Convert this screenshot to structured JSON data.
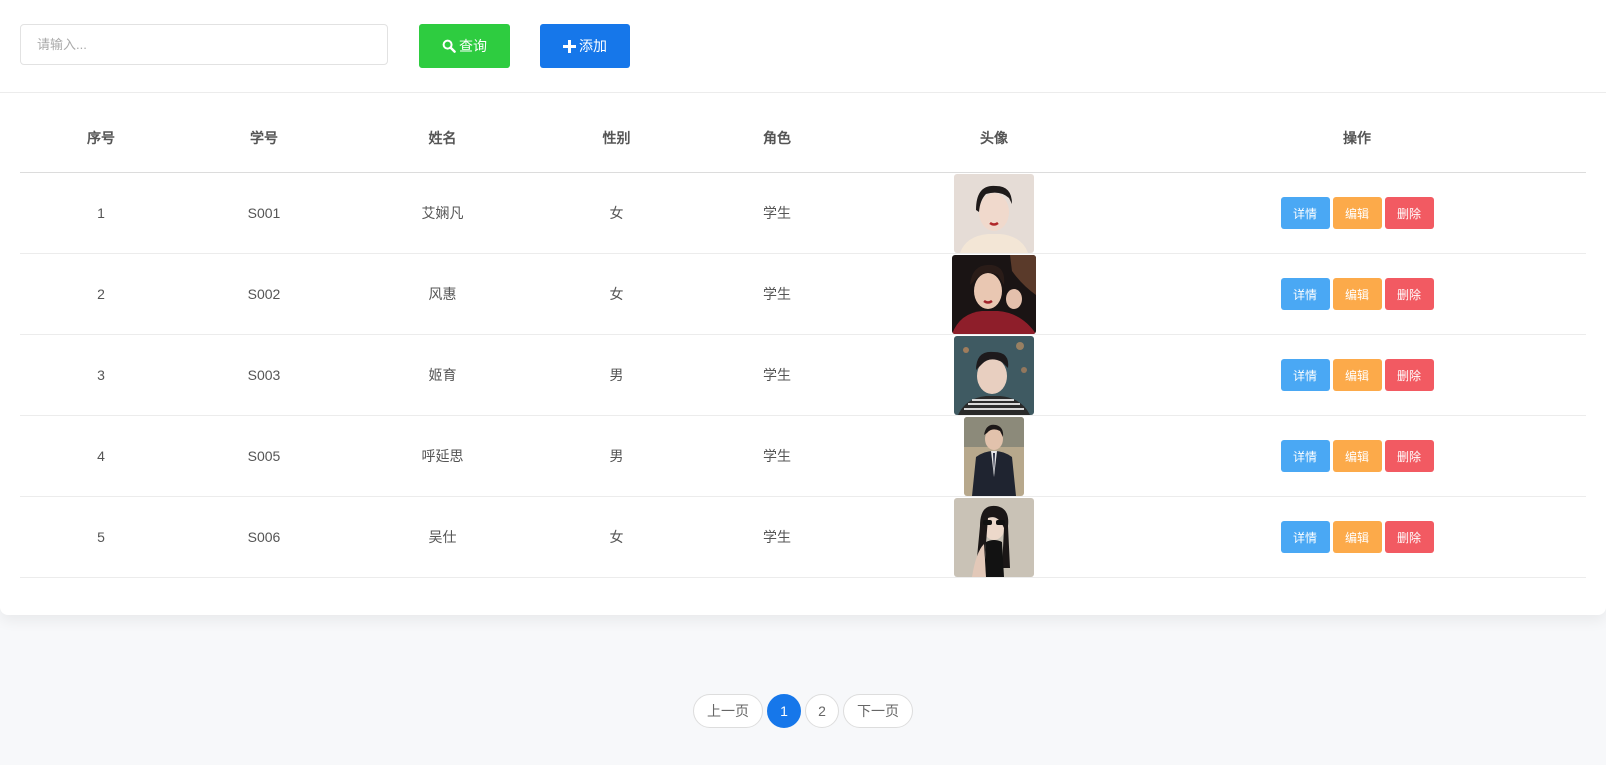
{
  "search": {
    "placeholder": "请输入..."
  },
  "toolbar": {
    "query_label": "查询",
    "add_label": "添加"
  },
  "table": {
    "columns": [
      "序号",
      "学号",
      "姓名",
      "性别",
      "角色",
      "头像",
      "操作"
    ],
    "rows": [
      {
        "index": "1",
        "student_id": "S001",
        "name": "艾娴凡",
        "gender": "女",
        "role": "学生",
        "avatar": "portrait-short-hair-woman"
      },
      {
        "index": "2",
        "student_id": "S002",
        "name": "风惠",
        "gender": "女",
        "role": "学生",
        "avatar": "portrait-woman-red-top"
      },
      {
        "index": "3",
        "student_id": "S003",
        "name": "姬育",
        "gender": "男",
        "role": "学生",
        "avatar": "portrait-man-striped-shirt"
      },
      {
        "index": "4",
        "student_id": "S005",
        "name": "呼延思",
        "gender": "男",
        "role": "学生",
        "avatar": "portrait-man-suit"
      },
      {
        "index": "5",
        "student_id": "S006",
        "name": "吴仕",
        "gender": "女",
        "role": "学生",
        "avatar": "portrait-woman-sunglasses"
      }
    ],
    "actions": {
      "detail": "详情",
      "edit": "编辑",
      "delete": "删除"
    }
  },
  "pagination": {
    "prev": "上一页",
    "pages": [
      "1",
      "2"
    ],
    "current": "1",
    "next": "下一页"
  },
  "colors": {
    "query": "#2ecc40",
    "add": "#1677ea",
    "detail": "#4aa8f4",
    "edit": "#fcaa4a",
    "delete": "#f25a62",
    "page_active": "#1677ea"
  }
}
